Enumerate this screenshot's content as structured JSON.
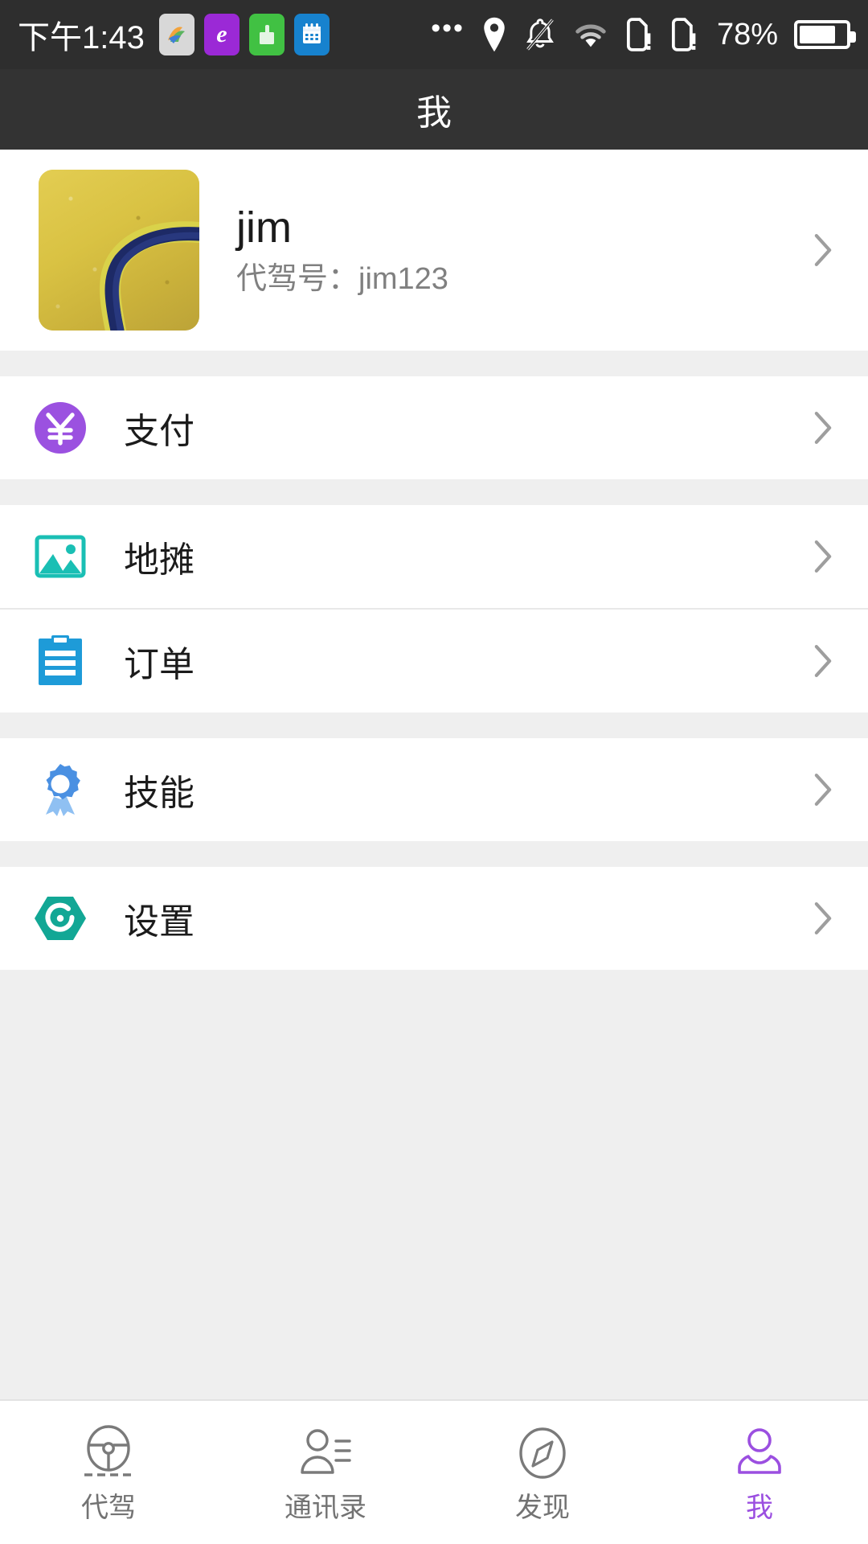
{
  "status_bar": {
    "clock": "下午1:43",
    "app_icons": [
      {
        "name": "photos-app-icon",
        "glyph": "🌈"
      },
      {
        "name": "browser-e-app-icon",
        "glyph": "e"
      },
      {
        "name": "green-app-icon",
        "glyph": ""
      },
      {
        "name": "calendar-app-icon",
        "glyph": ""
      }
    ],
    "overflow_dots": "•••",
    "icons": [
      "location-pin-icon",
      "bell-muted-icon",
      "wifi-icon",
      "sim1-alert-icon",
      "sim2-alert-icon"
    ],
    "battery_percent": "78%",
    "battery_level": 78
  },
  "header": {
    "title": "我"
  },
  "profile": {
    "name": "jim",
    "id_label": "代驾号：jim123",
    "avatar_alt": "golden-field-with-path"
  },
  "menu_groups": [
    {
      "items": [
        {
          "label": "支付",
          "icon": "yen-payment-icon",
          "color": "#9B51E0"
        }
      ]
    },
    {
      "items": [
        {
          "label": "地摊",
          "icon": "image-stall-icon",
          "color": "#1ABFB4"
        },
        {
          "label": "订单",
          "icon": "clipboard-order-icon",
          "color": "#1E9BD8"
        }
      ]
    },
    {
      "items": [
        {
          "label": "技能",
          "icon": "medal-skill-icon",
          "color": "#4A90E2"
        }
      ]
    },
    {
      "items": [
        {
          "label": "设置",
          "icon": "hexagon-settings-icon",
          "color": "#12A795"
        }
      ]
    }
  ],
  "chevron": "›",
  "tabs": [
    {
      "label": "代驾",
      "icon": "steering-wheel-icon",
      "active": false
    },
    {
      "label": "通讯录",
      "icon": "contacts-icon",
      "active": false
    },
    {
      "label": "发现",
      "icon": "compass-discover-icon",
      "active": false
    },
    {
      "label": "我",
      "icon": "person-me-icon",
      "active": true
    }
  ],
  "colors": {
    "accent": "#9B4FE0",
    "status_bar_bg": "#2E2E2E",
    "title_bar_bg": "#333333",
    "page_bg": "#EFEFEF",
    "card_bg": "#FFFFFF",
    "text_primary": "#1B1B1B",
    "text_secondary": "#808080",
    "tab_inactive": "#737373"
  }
}
